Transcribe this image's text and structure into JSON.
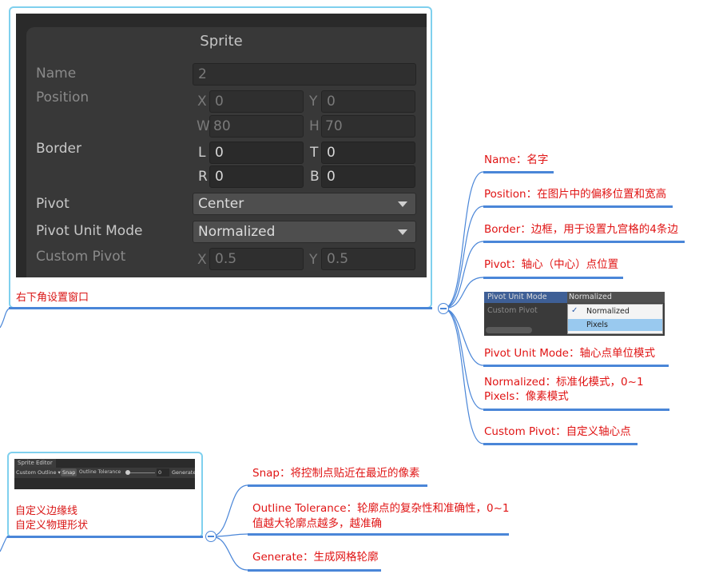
{
  "top_node": {
    "caption": "右下角设置窗口",
    "sprite_window": {
      "title": "Sprite",
      "name_label": "Name",
      "name_value": "2",
      "position_label": "Position",
      "pos_x_axis": "X",
      "pos_x": "0",
      "pos_y_axis": "Y",
      "pos_y": "0",
      "pos_w_axis": "W",
      "pos_w": "80",
      "pos_h_axis": "H",
      "pos_h": "70",
      "border_label": "Border",
      "border_l_axis": "L",
      "border_l": "0",
      "border_t_axis": "T",
      "border_t": "0",
      "border_r_axis": "R",
      "border_r": "0",
      "border_b_axis": "B",
      "border_b": "0",
      "pivot_label": "Pivot",
      "pivot_value": "Center",
      "pivot_unit_label": "Pivot Unit Mode",
      "pivot_unit_value": "Normalized",
      "custom_pivot_label": "Custom Pivot",
      "cp_x_axis": "X",
      "cp_x": "0.5",
      "cp_y_axis": "Y",
      "cp_y": "0.5"
    }
  },
  "top_branches": [
    {
      "text": "Name：名字"
    },
    {
      "text": "Position：在图片中的偏移位置和宽高"
    },
    {
      "text": "Border：边框，用于设置九宫格的4条边"
    },
    {
      "text": "Pivot：轴心（中心）点位置"
    },
    {
      "text": "Pivot Unit Mode：轴心点单位模式"
    },
    {
      "text_line1": "Normalized：标准化模式，0~1",
      "text_line2": "Pixels：像素模式"
    },
    {
      "text": "Custom Pivot：自定义轴心点"
    }
  ],
  "pivot_unit_shot": {
    "label": "Pivot Unit Mode",
    "value": "Normalized",
    "custom_pivot": "Custom Pivot",
    "options": [
      "Normalized",
      "Pixels"
    ],
    "check": "✓"
  },
  "bottom_node": {
    "caption_line1": "自定义边缘线",
    "caption_line2": "自定义物理形状",
    "sprite_editor": {
      "tab": "Sprite Editor",
      "mode": "Custom Outline ▾",
      "snap": "Snap",
      "tolerance_label": "Outline Tolerance",
      "tolerance_value": "0",
      "generate": "Generate"
    }
  },
  "bottom_branches": [
    {
      "text": "Snap：将控制点贴近在最近的像素"
    },
    {
      "text_line1": "Outline Tolerance：轮廓点的复杂性和准确性，0~1",
      "text_line2": "值越大轮廓点越多，越准确"
    },
    {
      "text": "Generate：生成网格轮廓"
    }
  ],
  "colors": {
    "branch_text": "#e01414",
    "line": "#4a86d8",
    "selection": "#7fd0ee"
  }
}
